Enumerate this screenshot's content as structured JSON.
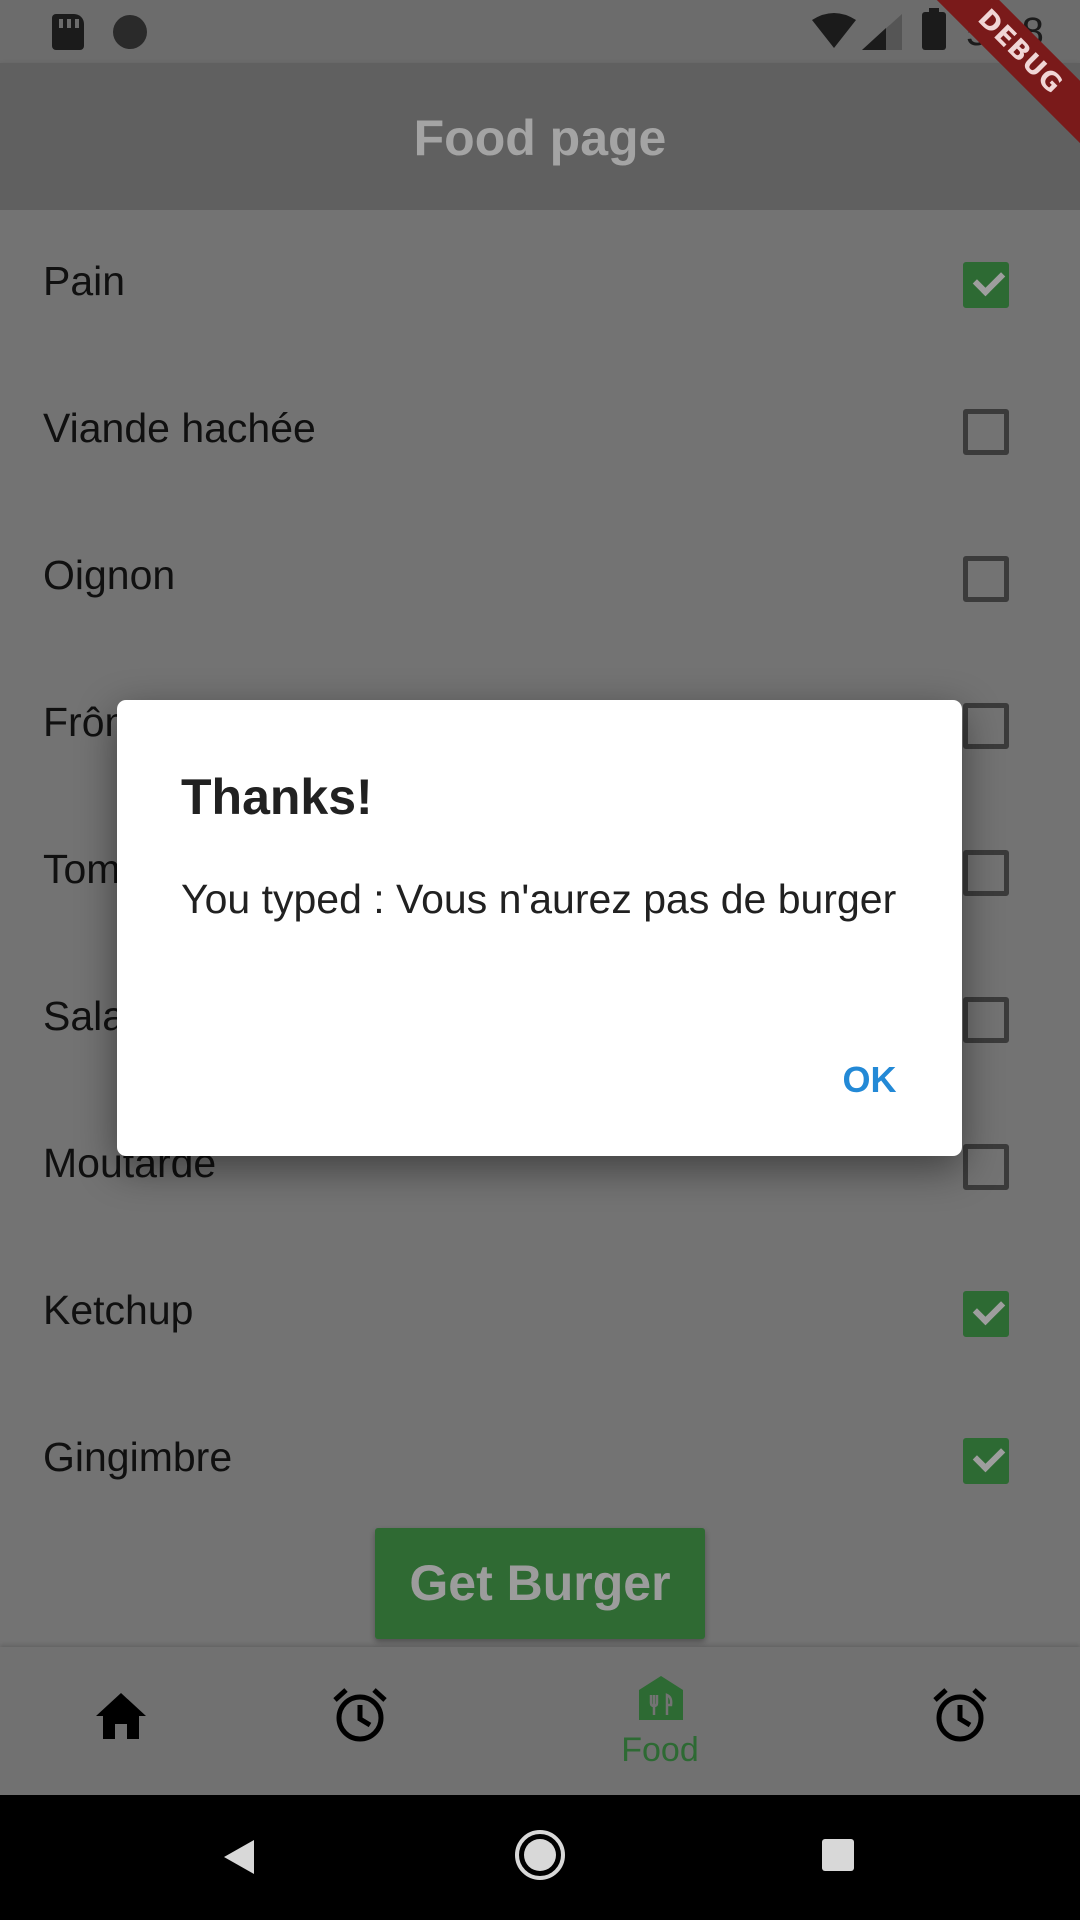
{
  "status_bar": {
    "time": "5:28"
  },
  "debug_banner": "DEBUG",
  "app_bar": {
    "title": "Food page"
  },
  "ingredients": [
    {
      "label": "Pain",
      "checked": true
    },
    {
      "label": "Viande hachée",
      "checked": false
    },
    {
      "label": "Oignon",
      "checked": false
    },
    {
      "label": "Frôm",
      "checked": false
    },
    {
      "label": "Tom",
      "checked": false
    },
    {
      "label": "Sala",
      "checked": false
    },
    {
      "label": "Moutarde",
      "checked": false
    },
    {
      "label": "Ketchup",
      "checked": true
    },
    {
      "label": "Gingimbre",
      "checked": true
    }
  ],
  "get_burger_label": "Get Burger",
  "bottom_nav": {
    "items": [
      {
        "icon": "home-icon",
        "label": ""
      },
      {
        "icon": "alarm-icon",
        "label": ""
      },
      {
        "icon": "food-store-icon",
        "label": "Food",
        "active": true
      },
      {
        "icon": "alarm-icon",
        "label": ""
      }
    ]
  },
  "dialog": {
    "title": "Thanks!",
    "message": "You typed : Vous n'aurez pas de burger",
    "ok_label": "OK"
  },
  "colors": {
    "accent_green": "#2d6a33",
    "dialog_button": "#2389d6"
  }
}
